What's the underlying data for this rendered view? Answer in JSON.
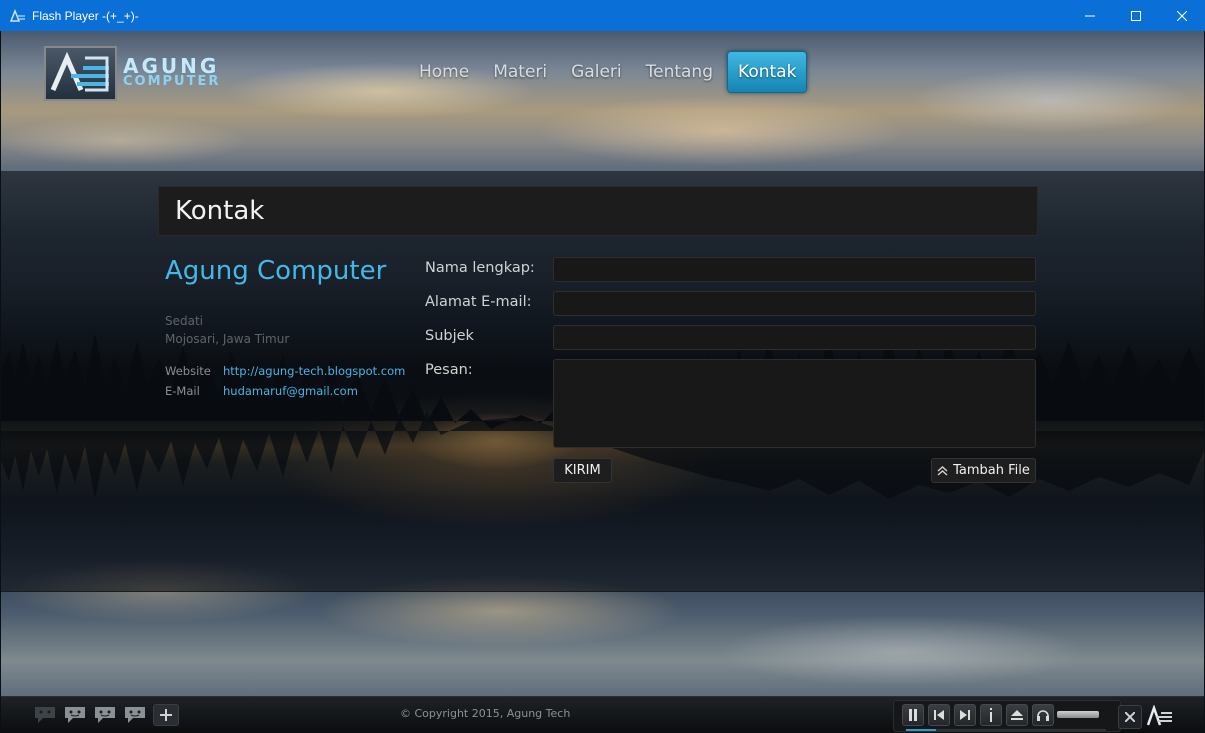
{
  "window": {
    "title": "Flash Player  -(+_+)-",
    "minimize_icon": "minimize-icon",
    "maximize_icon": "maximize-icon",
    "close_icon": "close-icon"
  },
  "logo": {
    "line1": "AGUNG",
    "line2": "COMPUTER"
  },
  "nav": {
    "items": [
      {
        "label": "Home"
      },
      {
        "label": "Materi"
      },
      {
        "label": "Galeri"
      },
      {
        "label": "Tentang"
      },
      {
        "label": "Kontak",
        "active": true
      }
    ],
    "active_color": "#2aa3d4"
  },
  "page": {
    "title": "Kontak"
  },
  "contact": {
    "company": "Agung Computer",
    "address_line1": "Sedati",
    "address_line2": "Mojosari, Jawa Timur",
    "website_label": "Website",
    "website_value": "http://agung-tech.blogspot.com",
    "email_label": "E-Mail",
    "email_value": "hudamaruf@gmail.com",
    "accent_color": "#43b8e6"
  },
  "form": {
    "name_label": "Nama lengkap:",
    "name_value": "",
    "email_label": "Alamat E-mail:",
    "email_value": "",
    "subject_label": "Subjek",
    "subject_value": "",
    "message_label": "Pesan:",
    "message_value": "",
    "send_label": "KIRIM",
    "attach_label": "Tambah File",
    "attach_icon": "upload-chevron-icon"
  },
  "footer": {
    "copyright": "© Copyright 2015, Agung Tech",
    "chat_icons": [
      "chat-icon",
      "chat-icon",
      "chat-icon",
      "chat-icon"
    ],
    "add_icon": "plus-icon",
    "player": {
      "buttons": [
        "pause-icon",
        "previous-icon",
        "next-icon",
        "info-icon",
        "eject-icon",
        "headphones-icon"
      ],
      "volume": 0.9,
      "progress": 0.15
    },
    "close_icon": "close-icon",
    "logo_icon": "agung-logo-icon"
  }
}
